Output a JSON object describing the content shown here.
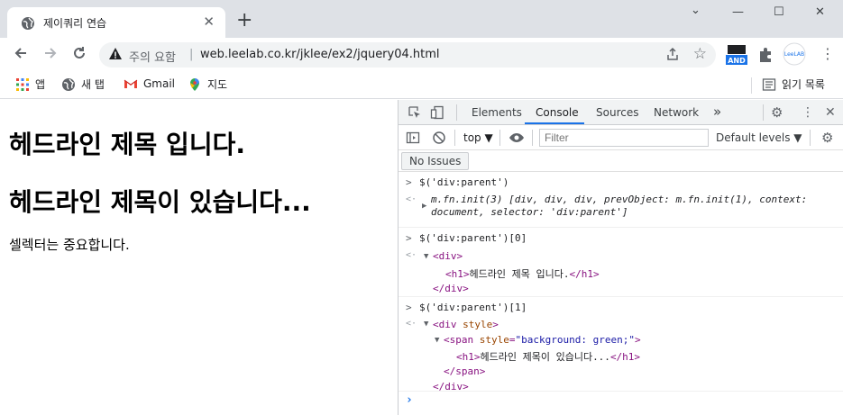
{
  "browser": {
    "tab": {
      "title": "제이쿼리 연습",
      "close": "✕"
    },
    "newtab": "+",
    "window_controls": {
      "minimize": "⌄",
      "minimize2": "—",
      "maximize": "☐",
      "close": "✕"
    },
    "omnibox": {
      "security_text": "주의 요함",
      "separator": "|",
      "url": "web.leelab.co.kr/jklee/ex2/jquery04.html"
    },
    "extensions": {
      "and_label": "AND",
      "leelab_label": "LeeLAB"
    },
    "bookmarks": [
      {
        "label": "앱",
        "icon": "apps-grid-icon"
      },
      {
        "label": "새 탭",
        "icon": "globe-icon"
      },
      {
        "label": "Gmail",
        "icon": "gmail-icon"
      },
      {
        "label": "지도",
        "icon": "maps-pin-icon"
      }
    ],
    "reading_list": "읽기 목록"
  },
  "page": {
    "heading1": "헤드라인 제목 입니다.",
    "heading2": "헤드라인 제목이 있습니다...",
    "paragraph": "셀렉터는 중요합니다."
  },
  "devtools": {
    "tabs": [
      "Elements",
      "Console",
      "Sources",
      "Network"
    ],
    "more": "»",
    "context": "top",
    "filter_placeholder": "Filter",
    "levels": "Default levels",
    "no_issues": "No Issues",
    "console": {
      "cmd1": "$('div:parent')",
      "res1_a": "m.fn.init(3) [div, div, div, prevObject: m.fn.init(1), context:",
      "res1_b": "document, selector: 'div:parent']",
      "cmd2": "$('div:parent')[0]",
      "cmd3": "$('div:parent')[1]",
      "h1_text_1": "헤드라인 제목 입니다.",
      "h1_text_2": "헤드라인 제목이 있습니다...",
      "span_style": "background: green;"
    },
    "accent_color": "#1a73e8"
  }
}
